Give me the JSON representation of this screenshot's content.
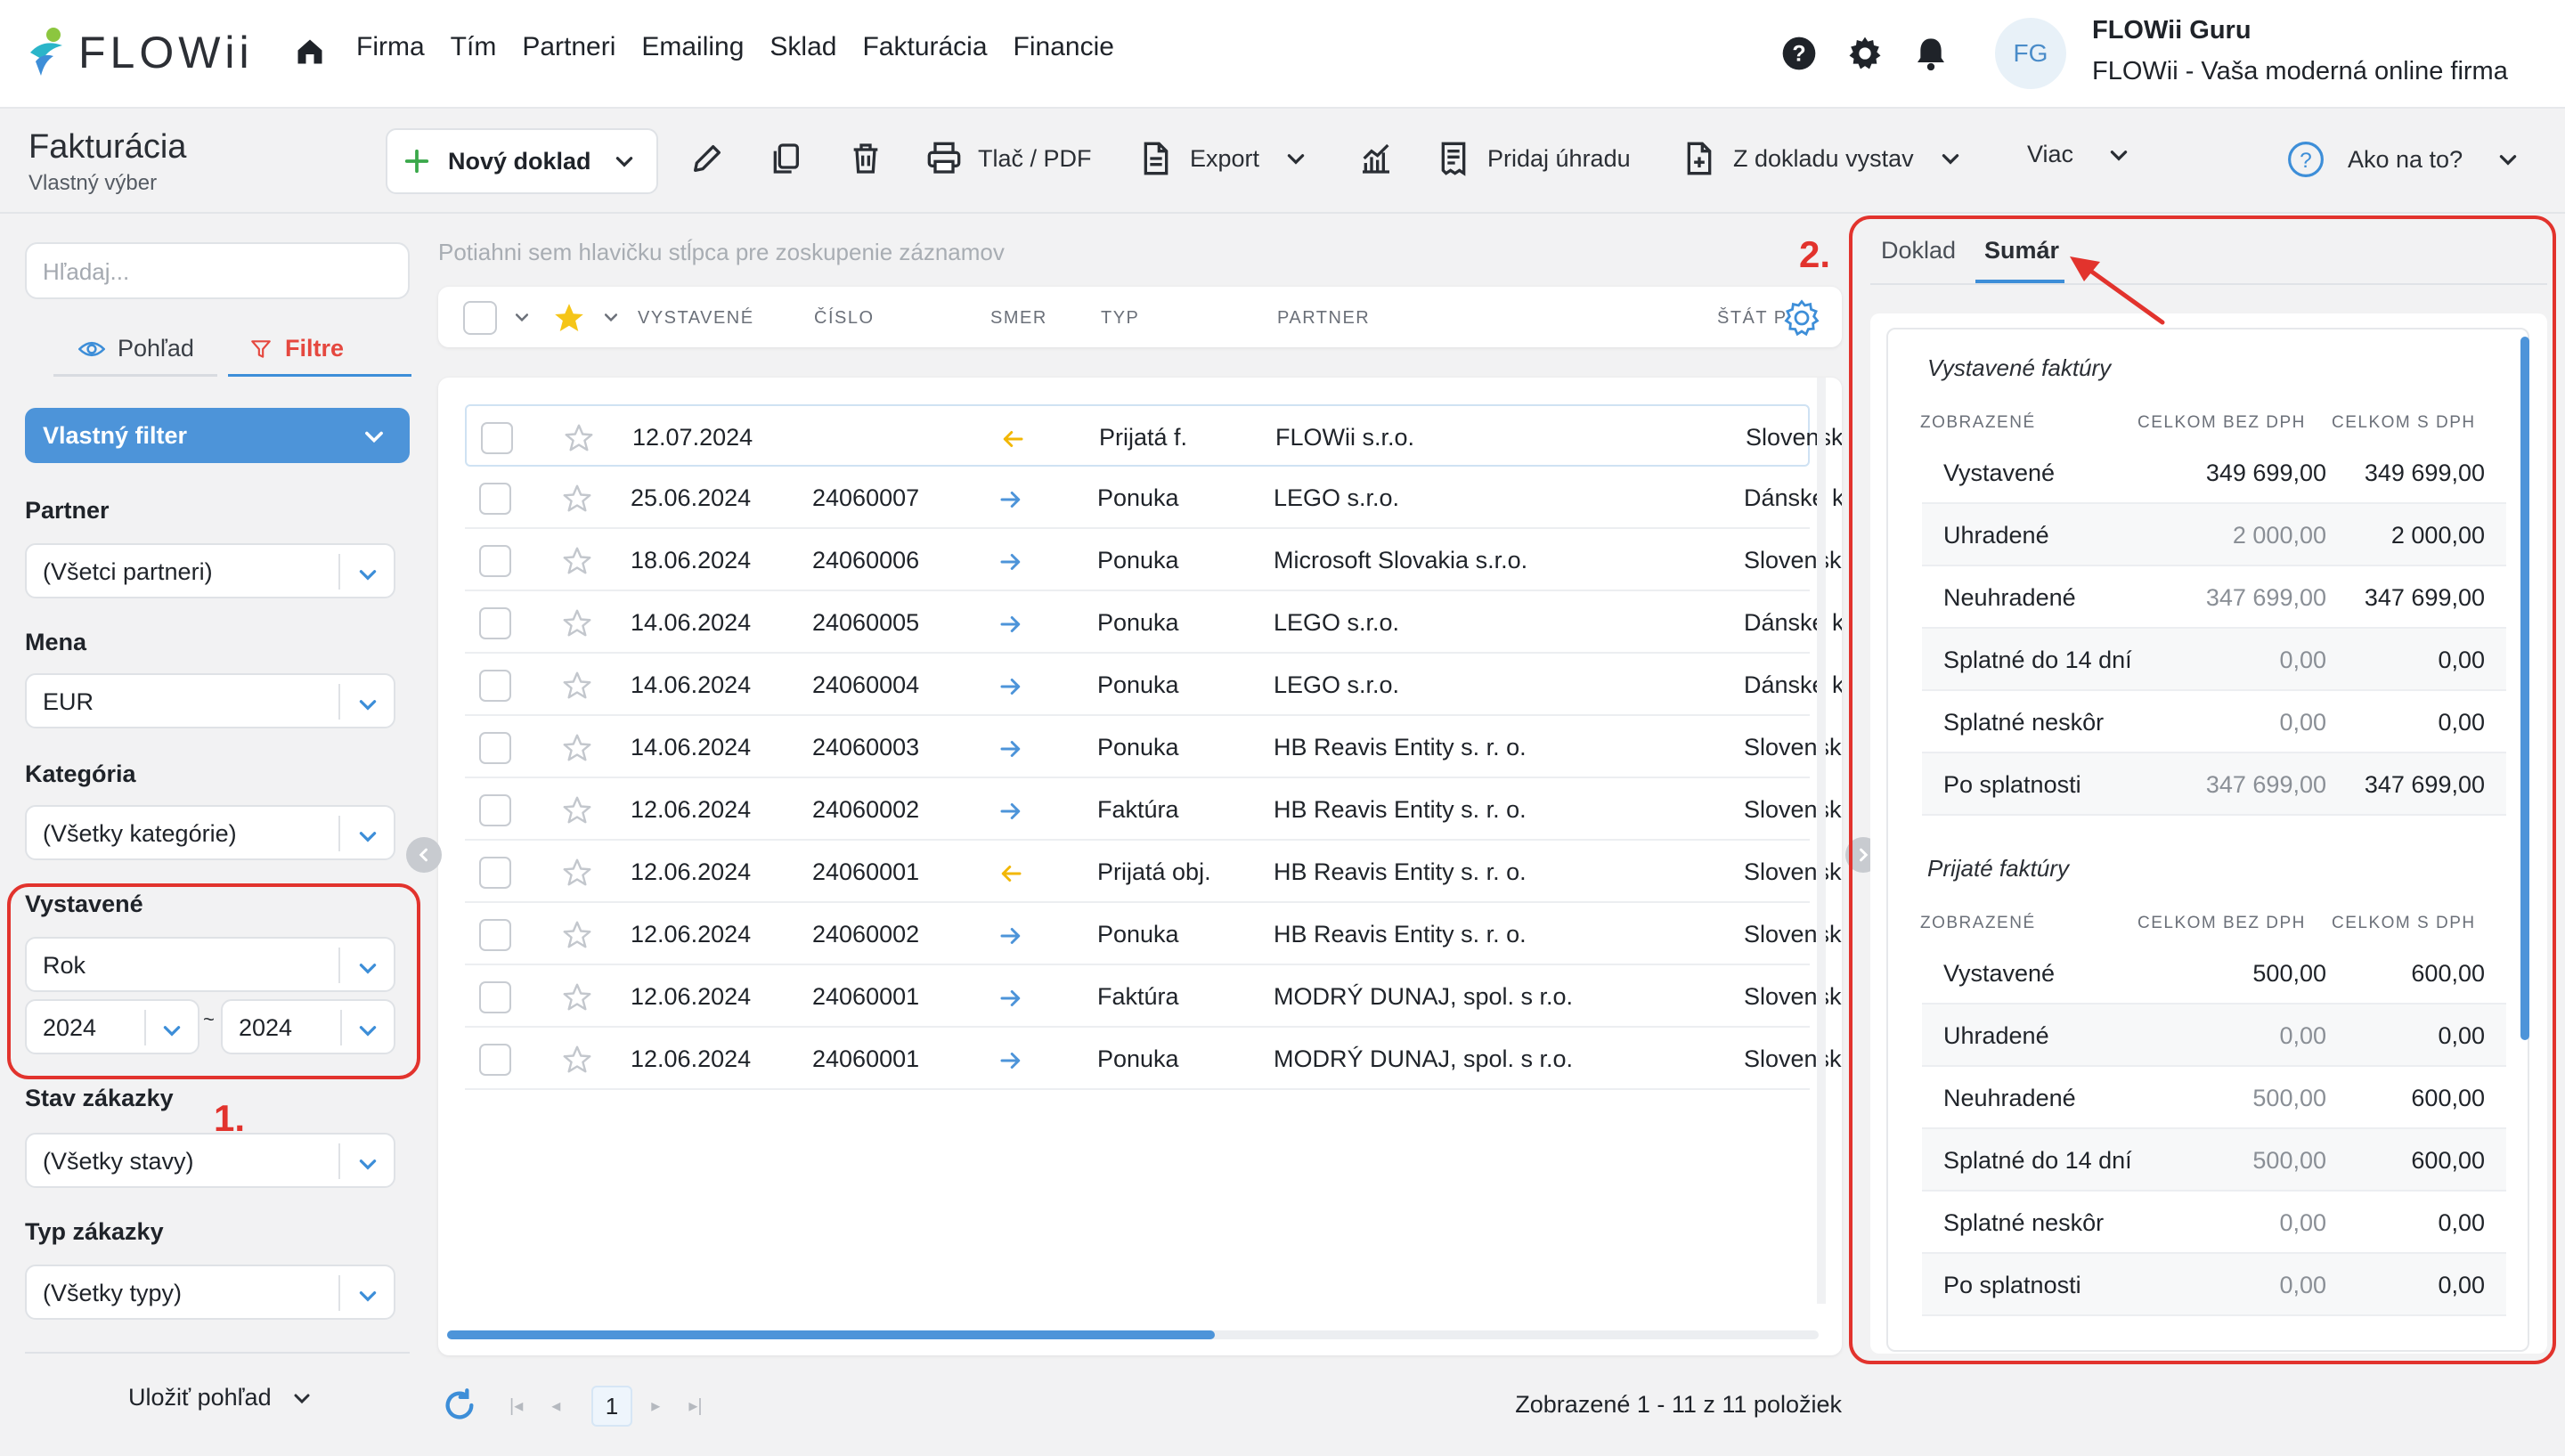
{
  "app": {
    "logo_text": "FLOWii",
    "nav": [
      "Firma",
      "Tím",
      "Partneri",
      "Emailing",
      "Sklad",
      "Fakturácia",
      "Financie"
    ],
    "user": {
      "initials": "FG",
      "name": "FLOWii Guru",
      "company": "FLOWii - Vaša moderná online firma"
    }
  },
  "toolbar": {
    "title": "Fakturácia",
    "subtitle": "Vlastný výber",
    "new_doc": "Nový doklad",
    "print_pdf": "Tlač / PDF",
    "export": "Export",
    "add_payment": "Pridaj úhradu",
    "from_doc": "Z dokladu vystav",
    "more": "Viac",
    "help": "Ako na to?"
  },
  "sidebar": {
    "search_placeholder": "Hľadaj...",
    "tab_view": "Pohľad",
    "tab_filters": "Filtre",
    "custom_filter": "Vlastný filter",
    "partner_label": "Partner",
    "partner_value": "(Všetci partneri)",
    "currency_label": "Mena",
    "currency_value": "EUR",
    "category_label": "Kategória",
    "category_value": "(Všetky kategórie)",
    "issued_label": "Vystavené",
    "issued_period": "Rok",
    "year_from": "2024",
    "range_sep": "~",
    "year_to": "2024",
    "order_state_label": "Stav zákazky",
    "order_state_value": "(Všetky stavy)",
    "order_type_label": "Typ zákazky",
    "order_type_value": "(Všetky typy)",
    "save_view": "Uložiť pohľad"
  },
  "annotations": {
    "marker1": "1.",
    "marker2": "2."
  },
  "grid": {
    "group_hint": "Potiahni sem hlavičku stĺpca pre zoskupenie záznamov",
    "headers": [
      "VYSTAVENÉ",
      "ČÍSLO",
      "SMER",
      "TYP",
      "PARTNER",
      "ŠTÁT P"
    ],
    "rows": [
      {
        "date": "12.07.2024",
        "number": "",
        "direction": "in",
        "type": "Prijatá f.",
        "partner": "FLOWii s.r.o.",
        "country": "Slovensk"
      },
      {
        "date": "25.06.2024",
        "number": "24060007",
        "direction": "out",
        "type": "Ponuka",
        "partner": "LEGO s.r.o.",
        "country": "Dánske k"
      },
      {
        "date": "18.06.2024",
        "number": "24060006",
        "direction": "out",
        "type": "Ponuka",
        "partner": "Microsoft Slovakia s.r.o.",
        "country": "Slovensk"
      },
      {
        "date": "14.06.2024",
        "number": "24060005",
        "direction": "out",
        "type": "Ponuka",
        "partner": "LEGO s.r.o.",
        "country": "Dánske k"
      },
      {
        "date": "14.06.2024",
        "number": "24060004",
        "direction": "out",
        "type": "Ponuka",
        "partner": "LEGO s.r.o.",
        "country": "Dánske k"
      },
      {
        "date": "14.06.2024",
        "number": "24060003",
        "direction": "out",
        "type": "Ponuka",
        "partner": "HB Reavis Entity s. r. o.",
        "country": "Slovensk"
      },
      {
        "date": "12.06.2024",
        "number": "24060002",
        "direction": "out",
        "type": "Faktúra",
        "partner": "HB Reavis Entity s. r. o.",
        "country": "Slovensk"
      },
      {
        "date": "12.06.2024",
        "number": "24060001",
        "direction": "in",
        "type": "Prijatá obj.",
        "partner": "HB Reavis Entity s. r. o.",
        "country": "Slovensk"
      },
      {
        "date": "12.06.2024",
        "number": "24060002",
        "direction": "out",
        "type": "Ponuka",
        "partner": "HB Reavis Entity s. r. o.",
        "country": "Slovensk"
      },
      {
        "date": "12.06.2024",
        "number": "24060001",
        "direction": "out",
        "type": "Faktúra",
        "partner": "MODRÝ DUNAJ, spol. s r.o.",
        "country": "Slovensk"
      },
      {
        "date": "12.06.2024",
        "number": "24060001",
        "direction": "out",
        "type": "Ponuka",
        "partner": "MODRÝ DUNAJ, spol. s r.o.",
        "country": "Slovensk"
      }
    ],
    "page": "1",
    "summary": "Zobrazené 1 - 11 z 11 položiek"
  },
  "panel": {
    "tab_doc": "Doklad",
    "tab_summary": "Sumár",
    "col_shown": "ZOBRAZENÉ",
    "col_no_vat": "CELKOM BEZ DPH",
    "col_vat": "CELKOM S DPH",
    "sections": [
      {
        "title": "Vystavené faktúry",
        "rows": [
          {
            "name": "Vystavené",
            "no_vat": "349 699,00",
            "vat": "349 699,00",
            "strong": true
          },
          {
            "name": "Uhradené",
            "no_vat": "2 000,00",
            "vat": "2 000,00",
            "strong": false
          },
          {
            "name": "Neuhradené",
            "no_vat": "347 699,00",
            "vat": "347 699,00",
            "strong": false
          },
          {
            "name": "Splatné do 14 dní",
            "no_vat": "0,00",
            "vat": "0,00",
            "strong": false
          },
          {
            "name": "Splatné neskôr",
            "no_vat": "0,00",
            "vat": "0,00",
            "strong": false
          },
          {
            "name": "Po splatnosti",
            "no_vat": "347 699,00",
            "vat": "347 699,00",
            "strong": false
          }
        ]
      },
      {
        "title": "Prijaté faktúry",
        "rows": [
          {
            "name": "Vystavené",
            "no_vat": "500,00",
            "vat": "600,00",
            "strong": true
          },
          {
            "name": "Uhradené",
            "no_vat": "0,00",
            "vat": "0,00",
            "strong": false
          },
          {
            "name": "Neuhradené",
            "no_vat": "500,00",
            "vat": "600,00",
            "strong": false
          },
          {
            "name": "Splatné do 14 dní",
            "no_vat": "500,00",
            "vat": "600,00",
            "strong": false
          },
          {
            "name": "Splatné neskôr",
            "no_vat": "0,00",
            "vat": "0,00",
            "strong": false
          },
          {
            "name": "Po splatnosti",
            "no_vat": "0,00",
            "vat": "0,00",
            "strong": false
          }
        ]
      }
    ]
  },
  "colors": {
    "accent": "#4d94d9",
    "annotation": "#e2332d",
    "filter_active": "#e5483f",
    "arrow_in": "#f2b705",
    "arrow_out": "#4d94d9"
  },
  "icons": [
    "home-icon",
    "help-icon",
    "gear-icon",
    "bell-icon",
    "plus-icon",
    "pencil-icon",
    "copy-icon",
    "trash-icon",
    "printer-icon",
    "document-icon",
    "chart-icon",
    "receipt-icon",
    "file-plus-icon",
    "question-circle-icon",
    "eye-icon",
    "funnel-icon",
    "star-icon",
    "refresh-icon"
  ]
}
